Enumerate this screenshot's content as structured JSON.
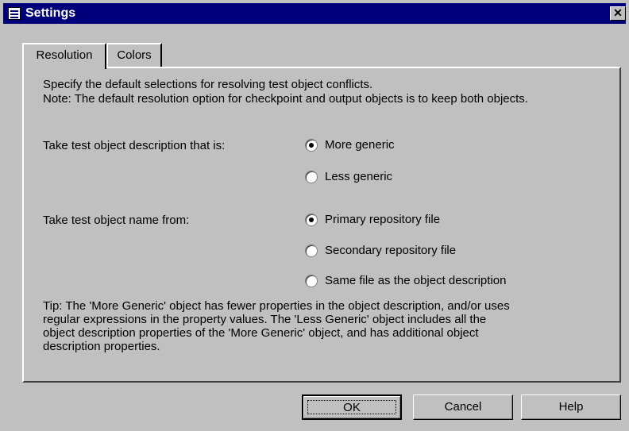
{
  "window": {
    "title": "Settings",
    "close_label": "✕"
  },
  "tabs": [
    {
      "label": "Resolution",
      "active": true
    },
    {
      "label": "Colors",
      "active": false
    }
  ],
  "intro": {
    "line1": "Specify the default selections for resolving test object conflicts.",
    "line2": "Note: The default resolution option for checkpoint and output objects is to keep both objects."
  },
  "description_group": {
    "label": "Take test object description that is:",
    "options": [
      {
        "label": "More generic",
        "checked": true
      },
      {
        "label": "Less generic",
        "checked": false
      }
    ]
  },
  "name_group": {
    "label": "Take test object name from:",
    "options": [
      {
        "label": "Primary repository file",
        "checked": true
      },
      {
        "label": "Secondary repository file",
        "checked": false
      },
      {
        "label": "Same file as the object description",
        "checked": false
      }
    ]
  },
  "tip": {
    "line1": "Tip: The 'More Generic' object has fewer properties in the object description, and/or uses",
    "line2": "regular expressions in the property values. The 'Less Generic' object includes all the",
    "line3": "object description properties of the 'More Generic' object, and has additional object",
    "line4": "description properties."
  },
  "buttons": {
    "ok": "OK",
    "cancel": "Cancel",
    "help": "Help"
  }
}
